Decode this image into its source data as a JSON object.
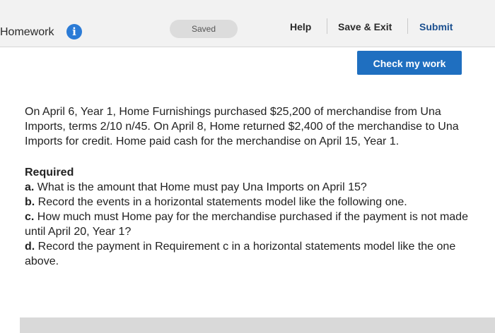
{
  "header": {
    "title": "Homework",
    "info_icon": "i",
    "saved_label": "Saved",
    "help_label": "Help",
    "save_exit_label": "Save & Exit",
    "submit_label": "Submit",
    "check_work_label": "Check my work"
  },
  "problem": {
    "statement": "On April 6, Year 1, Home Furnishings purchased $25,200 of merchandise from Una Imports, terms 2/10 n/45. On April 8, Home returned $2,400 of the merchandise to Una Imports for credit. Home paid cash for the merchandise on April 15, Year 1.",
    "required_heading": "Required",
    "items": [
      {
        "letter": "a.",
        "text": "What is the amount that Home must pay Una Imports on April 15?"
      },
      {
        "letter": "b.",
        "text": "Record the events in a horizontal statements model like the following one."
      },
      {
        "letter": "c.",
        "text": "How much must Home pay for the merchandise purchased if the payment is not made until April 20, Year 1?"
      },
      {
        "letter": "d.",
        "text": "Record the payment in Requirement c in a horizontal statements model like the one above."
      }
    ]
  },
  "colors": {
    "accent": "#1f6fc0",
    "info_icon": "#2b7bd6"
  }
}
